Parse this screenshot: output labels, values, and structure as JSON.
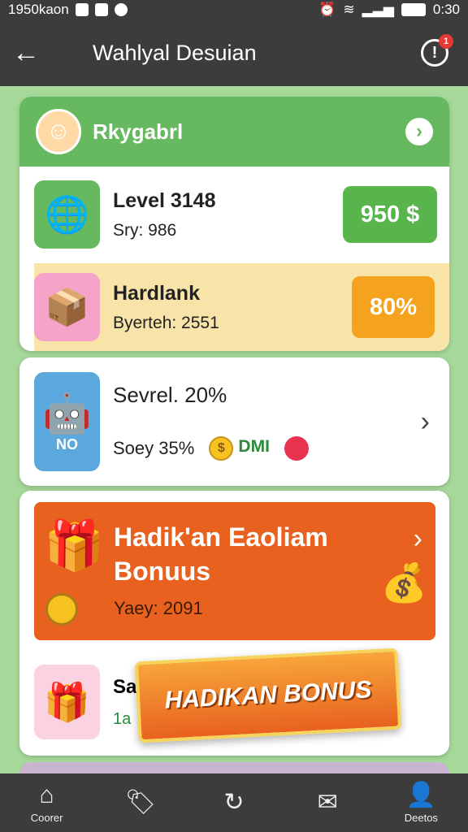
{
  "status_bar": {
    "time_left": "1950kaon",
    "time_right": "0:30"
  },
  "app_bar": {
    "title": "Wahlyal Desuian",
    "notification_count": "1"
  },
  "profile": {
    "name": "Rkygabrl"
  },
  "level_row": {
    "title": "Level 3148",
    "subtitle": "Sry: 986",
    "badge": "950 $"
  },
  "hard_row": {
    "title": "Hardlank",
    "subtitle": "Byerteh: 2551",
    "badge": "80%"
  },
  "sevrel_row": {
    "title": "Sevrel. 20%",
    "subtitle": "Soey 35%",
    "dm_label": "DMI",
    "tile_label": "NO"
  },
  "bonus": {
    "title": "Hadik'an Eaoliam Bonuus",
    "subtitle": "Yaey: 2091"
  },
  "gift_row": {
    "title": "Sa",
    "subtitle": "1a"
  },
  "banner": {
    "label": "HADIKAN BONUS"
  },
  "bottom_nav": [
    {
      "label": "Coorer",
      "icon": "home-icon"
    },
    {
      "label": "",
      "icon": "tag-icon"
    },
    {
      "label": "",
      "icon": "refresh-icon"
    },
    {
      "label": "",
      "icon": "mail-icon"
    },
    {
      "label": "Deetos",
      "icon": "profile-icon"
    }
  ],
  "colors": {
    "top_bar": "#3c3c3c",
    "green": "#67b960",
    "orange": "#e8611f",
    "yellow": "#f5a21f"
  }
}
